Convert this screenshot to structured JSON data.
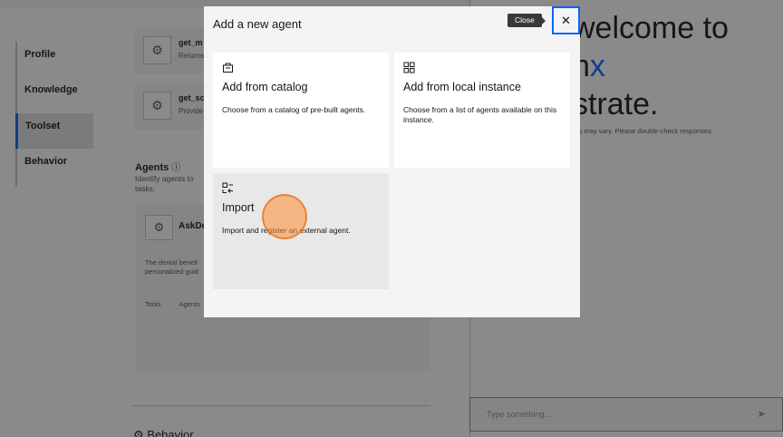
{
  "nav": {
    "items": [
      "Profile",
      "Knowledge",
      "Toolset",
      "Behavior"
    ],
    "active": "Toolset"
  },
  "tools": [
    {
      "name": "get_m",
      "desc": "Returns"
    },
    {
      "name": "get_sc",
      "desc": "Provide"
    }
  ],
  "agents": {
    "title": "Agents",
    "desc": "Identify agents to tasks.",
    "card": {
      "name": "AskDe",
      "text": "The dental benefi personalized guid",
      "meta_tools": "Tools",
      "meta_agents": "Agents"
    }
  },
  "behavior": {
    "heading": "Behavior"
  },
  "right": {
    "welcome_line1": "welcome to",
    "welcome_line2_x": "x",
    "welcome_line3": "strate.",
    "disclaimer": "ers may vary. Please double-check responses.",
    "chat_placeholder": "Type something..."
  },
  "modal": {
    "title": "Add a new agent",
    "close_tooltip": "Close",
    "tiles": [
      {
        "title": "Add from catalog",
        "desc": "Choose from a catalog of pre-built agents."
      },
      {
        "title": "Add from local instance",
        "desc": "Choose from a list of agents available on this instance."
      },
      {
        "title": "Import",
        "desc": "Import and register an external agent."
      }
    ]
  },
  "colors": {
    "accent": "#0f62fe",
    "overlay": "rgba(22,22,22,0.5)",
    "tile_hover": "#e8e8e8"
  }
}
